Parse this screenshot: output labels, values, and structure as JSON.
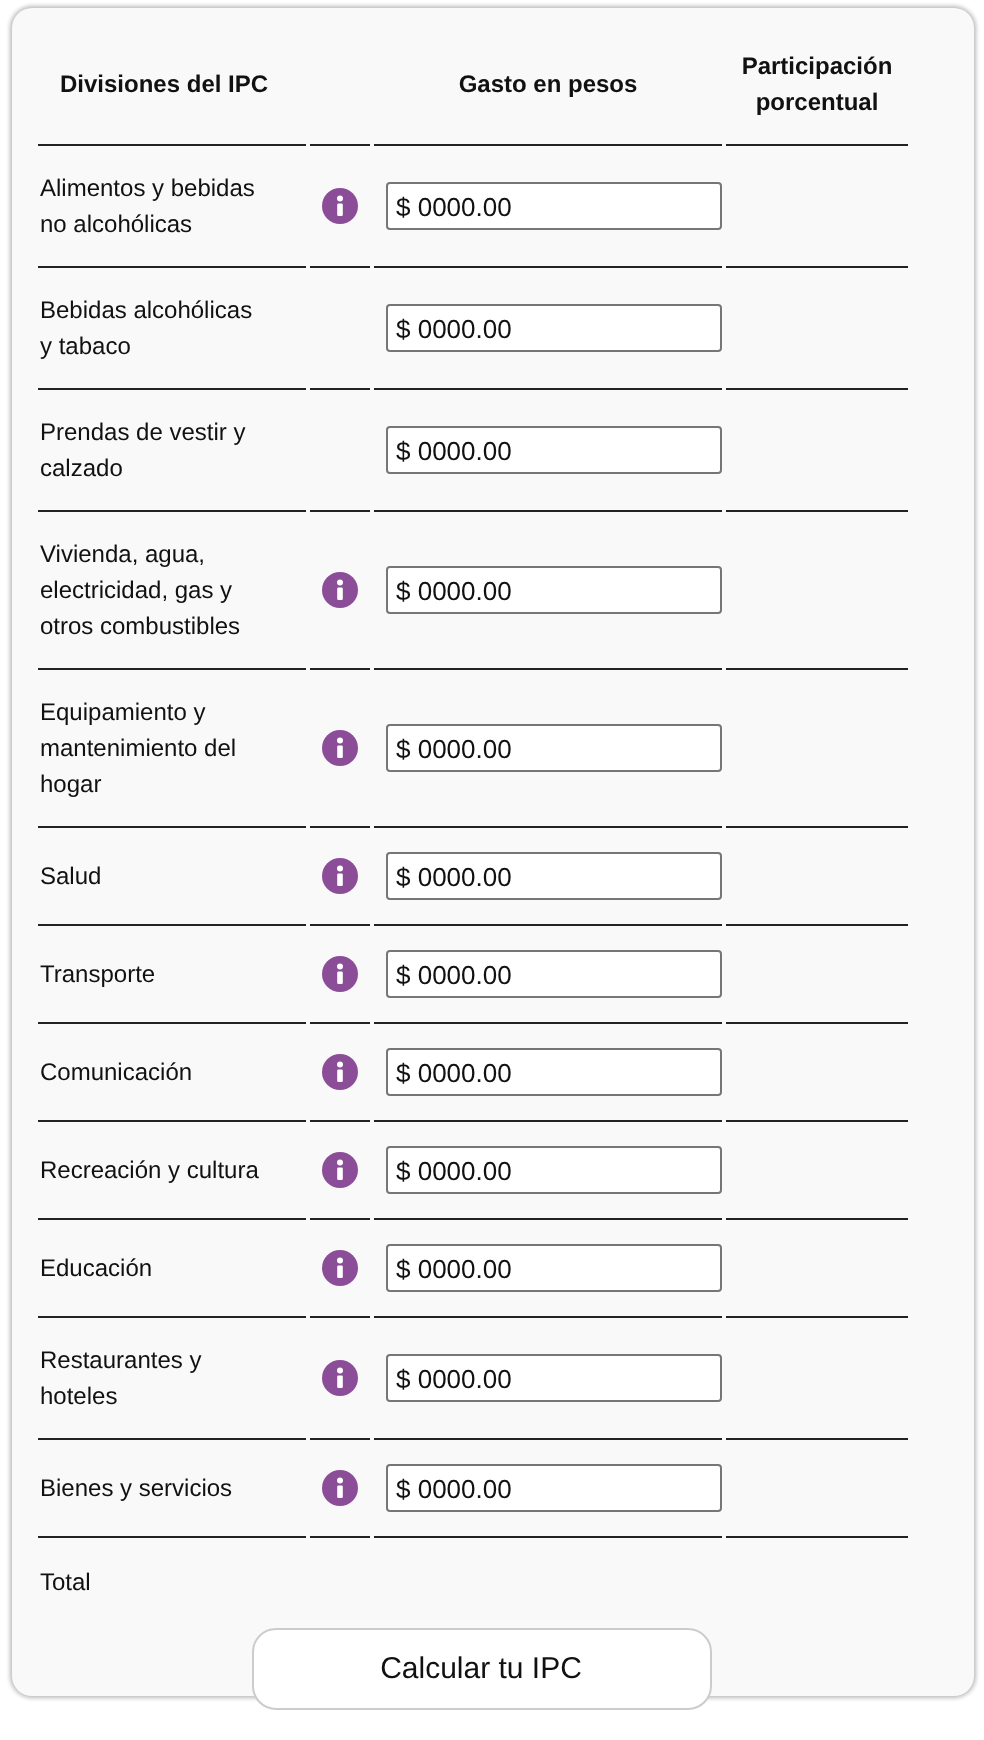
{
  "table": {
    "columns": [
      {
        "label": "Divisiones del IPC",
        "kind": "label"
      },
      {
        "label": "Gasto en pesos",
        "kind": "amount"
      },
      {
        "label": "Participación porcentual",
        "kind": "share"
      }
    ],
    "rows": [
      {
        "label": "Alimentos y bebidas no alcohólicas",
        "info": true,
        "value": "$ 0000.00"
      },
      {
        "label": "Bebidas alcohólicas y tabaco",
        "info": false,
        "value": "$ 0000.00"
      },
      {
        "label": "Prendas de vestir y calzado",
        "info": false,
        "value": "$ 0000.00"
      },
      {
        "label": "Vivienda, agua, electricidad, gas y otros combustibles",
        "info": true,
        "value": "$ 0000.00"
      },
      {
        "label": "Equipamiento y mantenimiento del hogar",
        "info": true,
        "value": "$ 0000.00"
      },
      {
        "label": "Salud",
        "info": true,
        "value": "$ 0000.00"
      },
      {
        "label": "Transporte",
        "info": true,
        "value": "$ 0000.00"
      },
      {
        "label": "Comunicación",
        "info": true,
        "value": "$ 0000.00"
      },
      {
        "label": "Recreación y cultura",
        "info": true,
        "value": "$ 0000.00"
      },
      {
        "label": "Educación",
        "info": true,
        "value": "$ 0000.00"
      },
      {
        "label": "Restaurantes y hoteles",
        "info": true,
        "value": "$ 0000.00"
      },
      {
        "label": "Bienes y servicios",
        "info": true,
        "value": "$ 0000.00"
      }
    ],
    "total": {
      "label": "Total"
    }
  },
  "button": {
    "label": "Calcular tu IPC"
  }
}
